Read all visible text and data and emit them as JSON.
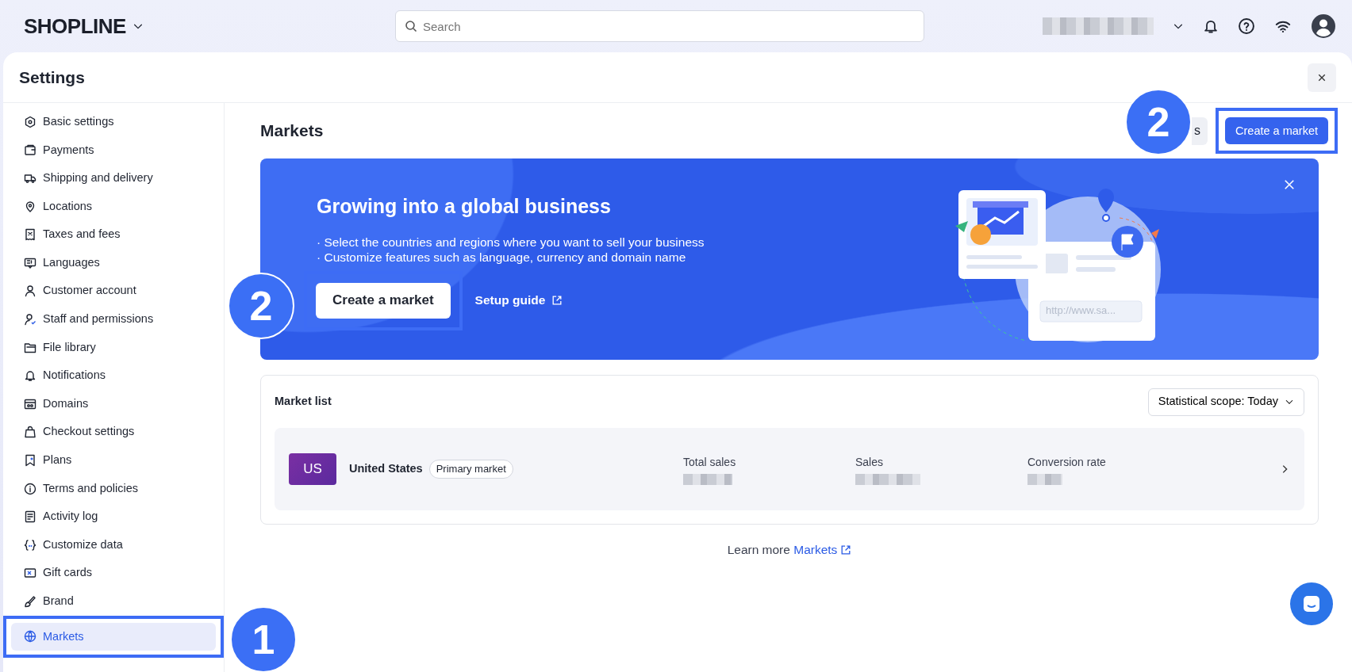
{
  "top_bar": {
    "logo": "SHOPLINE",
    "search": {
      "placeholder": "Search"
    }
  },
  "panel": {
    "title": "Settings"
  },
  "sidebar": {
    "items": [
      {
        "label": "Basic settings",
        "selected": false
      },
      {
        "label": "Payments",
        "selected": false
      },
      {
        "label": "Shipping and delivery",
        "selected": false
      },
      {
        "label": "Locations",
        "selected": false
      },
      {
        "label": "Taxes and fees",
        "selected": false
      },
      {
        "label": "Languages",
        "selected": false
      },
      {
        "label": "Customer account",
        "selected": false
      },
      {
        "label": "Staff and permissions",
        "selected": false
      },
      {
        "label": "File library",
        "selected": false
      },
      {
        "label": "Notifications",
        "selected": false
      },
      {
        "label": "Domains",
        "selected": false
      },
      {
        "label": "Checkout settings",
        "selected": false
      },
      {
        "label": "Plans",
        "selected": false
      },
      {
        "label": "Terms and policies",
        "selected": false
      },
      {
        "label": "Activity log",
        "selected": false
      },
      {
        "label": "Customize data",
        "selected": false
      },
      {
        "label": "Gift cards",
        "selected": false
      },
      {
        "label": "Brand",
        "selected": false
      },
      {
        "label": "Markets",
        "selected": true
      }
    ]
  },
  "page": {
    "title": "Markets",
    "header_buttons": [
      {
        "label": "s",
        "kind": "secondary"
      },
      {
        "label": "Create a market",
        "kind": "primary"
      }
    ]
  },
  "banner": {
    "title": "Growing into a global business",
    "bullets": [
      "· Select the countries and regions where you want to sell your business",
      "· Customize features such as language, currency and domain name"
    ],
    "button": "Create a market",
    "link": "Setup guide",
    "url_text": "http://www.sa..."
  },
  "market_list": {
    "title": "Market list",
    "scope": "Statistical scope: Today",
    "markets": [
      {
        "code": "US",
        "name": "United States",
        "tag": "Primary market",
        "metrics": [
          "Total sales",
          "Sales",
          "Conversion rate"
        ]
      }
    ]
  },
  "footer": {
    "prefix": "Learn more",
    "link": "Markets"
  },
  "annotations": [
    {
      "number": "1"
    },
    {
      "number": "2"
    },
    {
      "number": "2"
    }
  ]
}
